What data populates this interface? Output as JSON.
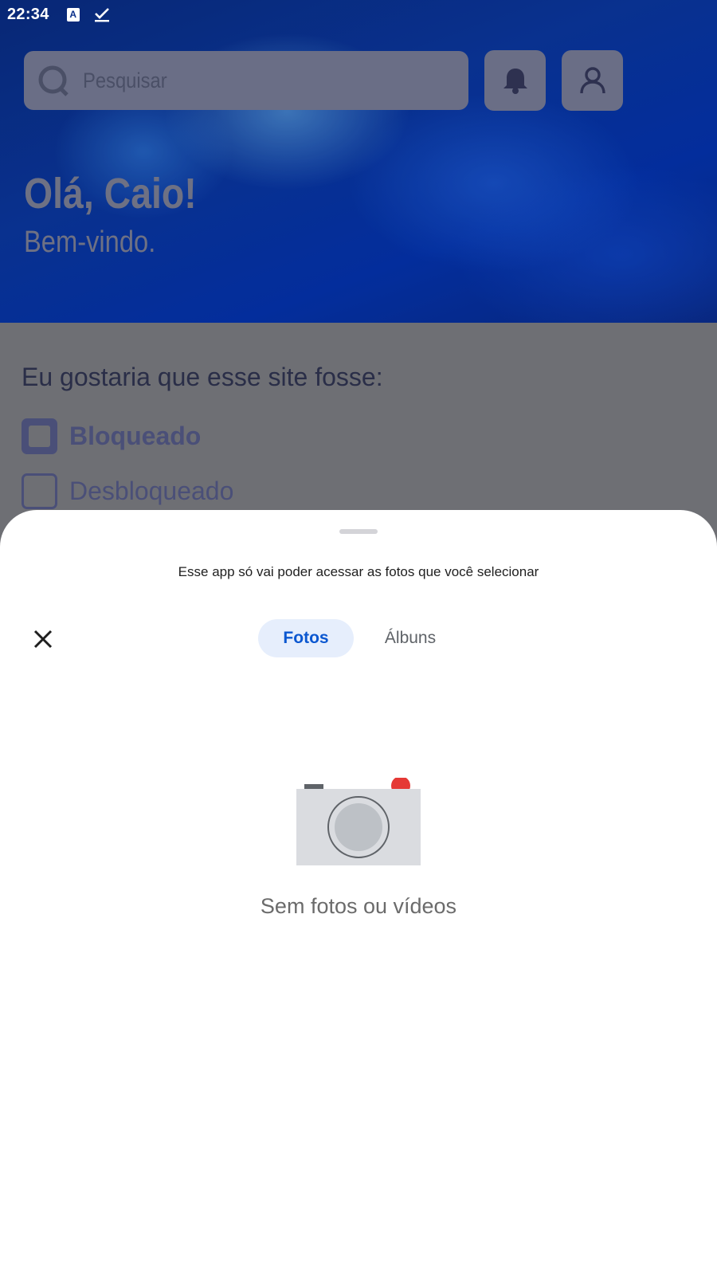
{
  "status_bar": {
    "time": "22:34",
    "icons": [
      "text-a-icon",
      "check-icon"
    ]
  },
  "header": {
    "search_placeholder": "Pesquisar",
    "greeting": "Olá, Caio!",
    "subgreeting": "Bem-vindo.",
    "buttons": [
      "bell-icon",
      "profile-icon"
    ]
  },
  "preferences": {
    "prompt": "Eu gostaria que esse site fosse:",
    "options": [
      {
        "label": "Bloqueado",
        "selected": true
      },
      {
        "label": "Desbloqueado",
        "selected": false
      }
    ]
  },
  "photo_picker": {
    "message": "Esse app só vai poder acessar as fotos que você selecionar",
    "tabs": [
      {
        "label": "Fotos",
        "active": true
      },
      {
        "label": "Álbuns",
        "active": false
      }
    ],
    "empty_state": "Sem fotos ou vídeos"
  },
  "colors": {
    "accent": "#0b57d0",
    "active_tab_bg": "#e6eefc",
    "camera_red": "#e53935"
  }
}
